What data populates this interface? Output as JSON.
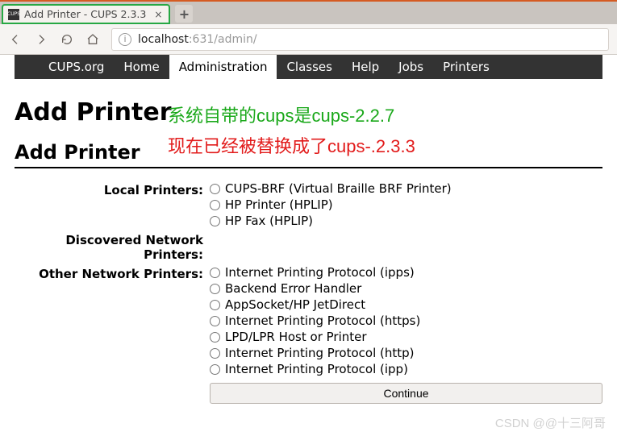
{
  "browser": {
    "tab_title": "Add Printer - CUPS 2.3.3",
    "url_host": "localhost",
    "url_port": ":631",
    "url_path": "/admin/",
    "new_tab_glyph": "+",
    "close_glyph": "×"
  },
  "cups_nav": {
    "items": [
      "CUPS.org",
      "Home",
      "Administration",
      "Classes",
      "Help",
      "Jobs",
      "Printers"
    ],
    "active_index": 2
  },
  "page": {
    "title_main": "Add Printer",
    "title_sub": "Add Printer"
  },
  "annotations": {
    "green": "系统自带的cups是cups-2.2.7",
    "red": "现在已经被替换成了cups-.2.3.3"
  },
  "form": {
    "sections": [
      {
        "label": "Local Printers:",
        "options": [
          "CUPS-BRF (Virtual Braille BRF Printer)",
          "HP Printer (HPLIP)",
          "HP Fax (HPLIP)"
        ]
      },
      {
        "label": "Discovered Network Printers:",
        "options": []
      },
      {
        "label": "Other Network Printers:",
        "options": [
          "Internet Printing Protocol (ipps)",
          "Backend Error Handler",
          "AppSocket/HP JetDirect",
          "Internet Printing Protocol (https)",
          "LPD/LPR Host or Printer",
          "Internet Printing Protocol (http)",
          "Internet Printing Protocol (ipp)"
        ]
      }
    ],
    "continue_label": "Continue"
  },
  "watermark": "CSDN @@十三阿哥"
}
